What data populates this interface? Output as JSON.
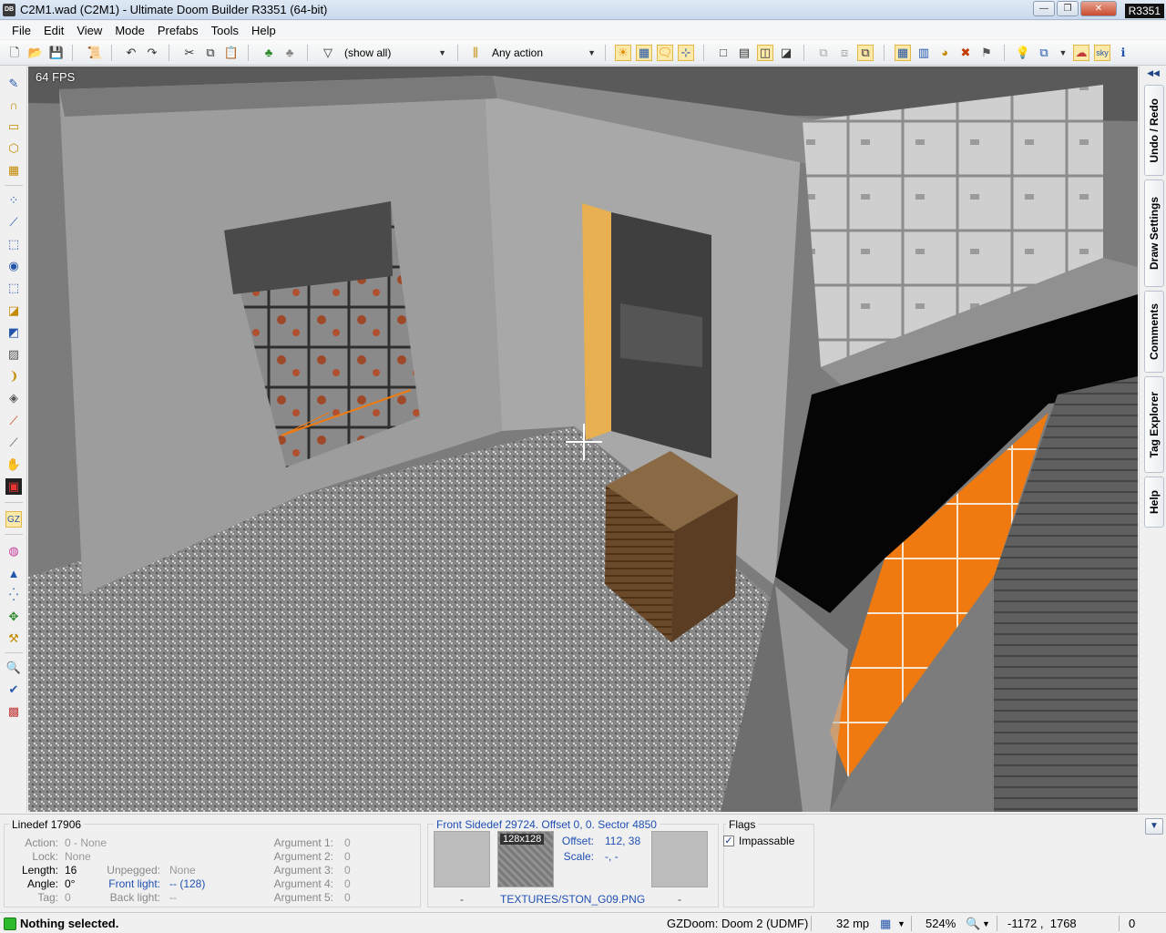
{
  "window": {
    "app_icon": "DB",
    "title": "C2M1.wad (C2M1) - Ultimate Doom Builder R3351 (64-bit)",
    "minimize": "—",
    "restore": "❐",
    "close": "✕",
    "revision_badge": "R3351"
  },
  "menu": [
    "File",
    "Edit",
    "View",
    "Mode",
    "Prefabs",
    "Tools",
    "Help"
  ],
  "toolbar": {
    "filter_combo": "(show all)",
    "action_combo": "Any action"
  },
  "viewport": {
    "fps": "64 FPS"
  },
  "dock_tabs": [
    "Undo / Redo",
    "Draw Settings",
    "Comments",
    "Tag Explorer",
    "Help"
  ],
  "linedef": {
    "title": "Linedef 17906",
    "fields": [
      {
        "label": "Action:",
        "value": "0 - None",
        "dim": true
      },
      {
        "label": "Lock:",
        "value": "None",
        "dim": true
      },
      {
        "label": "Length:",
        "value": "16",
        "dim": false
      },
      {
        "label": "Angle:",
        "value": "0°",
        "dim": false
      },
      {
        "label": "Tag:",
        "value": "0",
        "dim": true
      }
    ],
    "unpegged_label": "Unpegged:",
    "unpegged_value": "None",
    "front_light_label": "Front light:",
    "front_light_value": "-- (128)",
    "back_light_label": "Back light:",
    "back_light_value": "--",
    "arguments": [
      {
        "label": "Argument 1:",
        "value": "0"
      },
      {
        "label": "Argument 2:",
        "value": "0"
      },
      {
        "label": "Argument 3:",
        "value": "0"
      },
      {
        "label": "Argument 4:",
        "value": "0"
      },
      {
        "label": "Argument 5:",
        "value": "0"
      }
    ]
  },
  "sidedef": {
    "title": "Front Sidedef 29724. Offset 0, 0. Sector 4850",
    "upper_name": "-",
    "middle_size": "128x128",
    "middle_name": "TEXTURES/STON_G09.PNG",
    "lower_name": "-",
    "offset_label": "Offset:",
    "offset_value": "112, 38",
    "scale_label": "Scale:",
    "scale_value": "-, -"
  },
  "flags": {
    "title": "Flags",
    "items": [
      {
        "label": "Impassable",
        "checked": true
      }
    ]
  },
  "status": {
    "message": "Nothing selected.",
    "engine": "GZDoom: Doom 2 (UDMF)",
    "grid": "32 mp",
    "zoom": "524%",
    "coords": "-1172 ,  1768",
    "counter": "0"
  },
  "colors": {
    "accent_orange": "#f07a10",
    "highlight_yellow": "#e8b050",
    "status_green": "#2dbb2d"
  }
}
